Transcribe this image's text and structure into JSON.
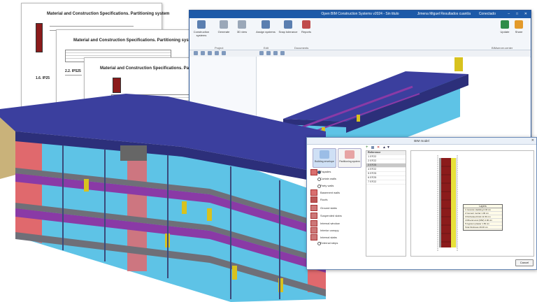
{
  "documents": [
    {
      "title": "Material and Construction Specifications. Partitioning system",
      "section": "1.6. IP25"
    },
    {
      "title": "Material and Construction Specifications. Partitioning system",
      "section": "2.2. IP525"
    },
    {
      "title": "Material and Construction Specifications. Partitioning system",
      "section": ""
    }
  ],
  "app": {
    "title": "Open BIM Construction Systems v2024 - Sin titulo",
    "user": "Jimena Miguel",
    "status_items": [
      "Resultados cuantía",
      "Conectado"
    ],
    "ribbon": {
      "buttons": [
        "Construction systems",
        "Generate",
        "3D view",
        "Assign systems",
        "Snap tolerance",
        "Reports",
        "Update",
        "Share"
      ],
      "groups": [
        "Project",
        "Edit",
        "Documents",
        "BIMserver.center"
      ]
    }
  },
  "dialog": {
    "title": "BIM model",
    "tabs": [
      "Building envelope",
      "Partitioning system"
    ],
    "categories": [
      "Façades",
      "Curtain walls",
      "Party walls",
      "Basement walls",
      "Roofs",
      "Ground slabs",
      "Suspended slabs",
      "Internal window",
      "Interior canopy",
      "Internal slabs",
      "External steps"
    ],
    "references_header": "Reference",
    "references": [
      {
        "n": "1",
        "ref": "EF22"
      },
      {
        "n": "2",
        "ref": "EF22"
      },
      {
        "n": "3",
        "ref": "EF25"
      },
      {
        "n": "4",
        "ref": "EF22"
      },
      {
        "n": "5",
        "ref": "EF25"
      },
      {
        "n": "6",
        "ref": "EF25"
      },
      {
        "n": "7",
        "ref": "EF22"
      }
    ],
    "selected_index": 2,
    "layers_title": "Layers",
    "layers": [
      "1  Ceramic cladding  0.00 cm",
      "2  Cement mortar  1.00 cm",
      "3  Perforated brick  11.50 cm",
      "4  Mineral wool (MW)  4.00 cm",
      "5  Gypsum plaster  1.50 cm",
      "Total thickness  29.00 cm"
    ],
    "cancel_label": "Cancel"
  },
  "colors": {
    "roof": "#3b3f9e",
    "wall_cyan": "#5ec3e6",
    "wall_red": "#e0696d",
    "slab_purple": "#8a3aa6",
    "door_yellow": "#d8c21e",
    "accent": "#1d5aa8"
  }
}
